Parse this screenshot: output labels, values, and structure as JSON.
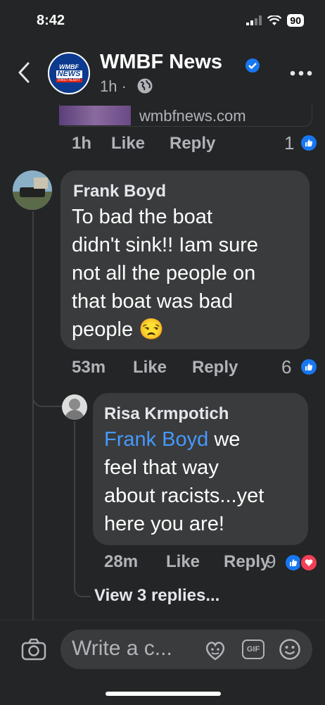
{
  "status_bar": {
    "time": "8:42",
    "battery": "90"
  },
  "header": {
    "page_name": "WMBF News",
    "post_time": "1h ·",
    "logo_text_top": "WMBF",
    "logo_text_mid": "NEWS",
    "logo_text_bottom": "FIRST ALERT"
  },
  "link_preview": {
    "domain": "wmbfnews.com"
  },
  "top_comment_actions": {
    "time": "1h",
    "like": "Like",
    "reply": "Reply",
    "reactions": "1"
  },
  "comments": [
    {
      "author": "Frank Boyd",
      "text_lines": [
        "To bad the boat",
        "didn't sink!! Iam sure",
        "not all the people on",
        "that boat was bad",
        "people 😒"
      ],
      "time": "53m",
      "like": "Like",
      "reply": "Reply",
      "reactions": "6"
    },
    {
      "author": "Risa Krmpotich",
      "mention": "Frank Boyd",
      "text_first_rest": " we",
      "text_lines": [
        "feel that way",
        "about racists...yet",
        "here you are!"
      ],
      "time": "28m",
      "like": "Like",
      "reply": "Reply",
      "reactions": "9"
    }
  ],
  "view_replies": "View 3 replies...",
  "composer": {
    "placeholder": "Write a c...",
    "gif_label": "GIF"
  },
  "colors": {
    "background": "#242526",
    "bubble": "#3a3b3c",
    "accent": "#1877f2",
    "mention": "#4599ff",
    "love": "#f33e58"
  },
  "icons": [
    "back-arrow-icon",
    "verified-icon",
    "globe-icon",
    "more-icon",
    "like-icon",
    "love-icon",
    "camera-icon",
    "avatar-sticker-icon",
    "gif-icon",
    "emoji-icon"
  ]
}
